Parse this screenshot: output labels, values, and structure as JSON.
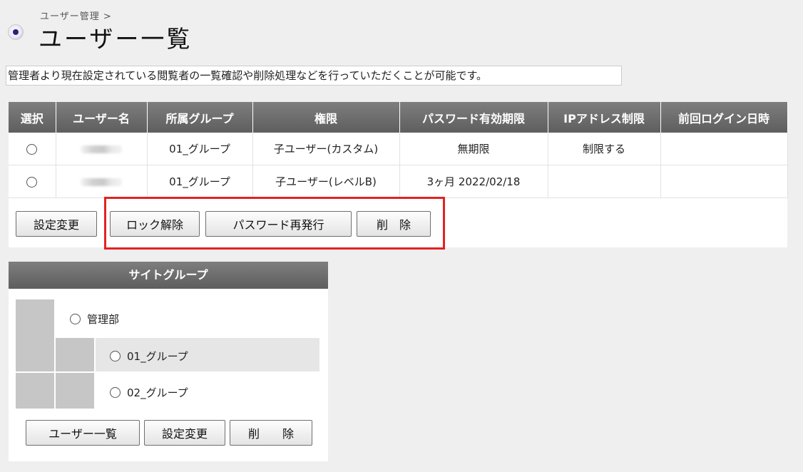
{
  "breadcrumb": "ユーザー管理 >",
  "title": "ユーザー一覧",
  "description": "管理者より現在設定されている閲覧者の一覧確認や削除処理などを行っていただくことが可能です。",
  "table": {
    "headers": [
      "選択",
      "ユーザー名",
      "所属グループ",
      "権限",
      "パスワード有効期限",
      "IPアドレス制限",
      "前回ログイン日時"
    ],
    "rows": [
      {
        "group": "01_グループ",
        "role": "子ユーザー(カスタム)",
        "pw_expiry": "無期限",
        "ip": "制限する",
        "last_login": ""
      },
      {
        "group": "01_グループ",
        "role": "子ユーザー(レベルB)",
        "pw_expiry": "3ヶ月 2022/02/18",
        "ip": "",
        "last_login": ""
      }
    ]
  },
  "actions": {
    "settings": "設定変更",
    "unlock": "ロック解除",
    "reissue_password": "パスワード再発行",
    "delete": "削　除"
  },
  "site_group": {
    "header": "サイトグループ",
    "items": [
      "管理部",
      "01_グループ",
      "02_グループ"
    ],
    "buttons": {
      "user_list": "ユーザー一覧",
      "settings": "設定変更",
      "delete": "削　　除"
    }
  },
  "colors": {
    "header_bg": "#6e6e6e",
    "highlight": "#e32222",
    "page_bg": "#efefef"
  }
}
